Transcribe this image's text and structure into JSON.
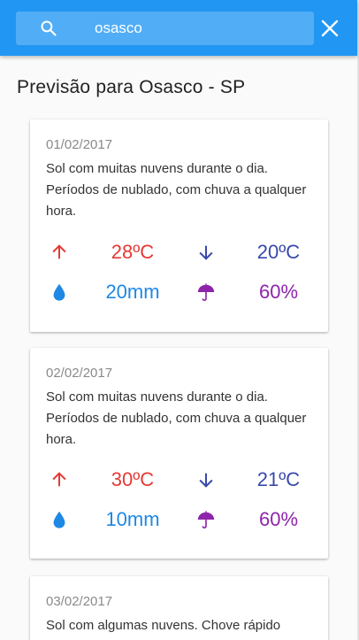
{
  "search": {
    "query": "osasco"
  },
  "page_title": "Previsão para Osasco - SP",
  "colors": {
    "appbar": "#2196f3",
    "max_temp": "#e53935",
    "min_temp": "#3949ab",
    "rain": "#1e88e5",
    "rain_probability": "#8e24aa"
  },
  "forecasts": [
    {
      "date": "01/02/2017",
      "description": "Sol com muitas nuvens durante o dia. Períodos de nublado, com chuva a qualquer hora.",
      "max_temp": "28ºC",
      "min_temp": "20ºC",
      "rain": "20mm",
      "rain_probability": "60%"
    },
    {
      "date": "02/02/2017",
      "description": "Sol com muitas nuvens durante o dia. Períodos de nublado, com chuva a qualquer hora.",
      "max_temp": "30ºC",
      "min_temp": "21ºC",
      "rain": "10mm",
      "rain_probability": "60%"
    },
    {
      "date": "03/02/2017",
      "description": "Sol com algumas nuvens. Chove rápido"
    }
  ]
}
